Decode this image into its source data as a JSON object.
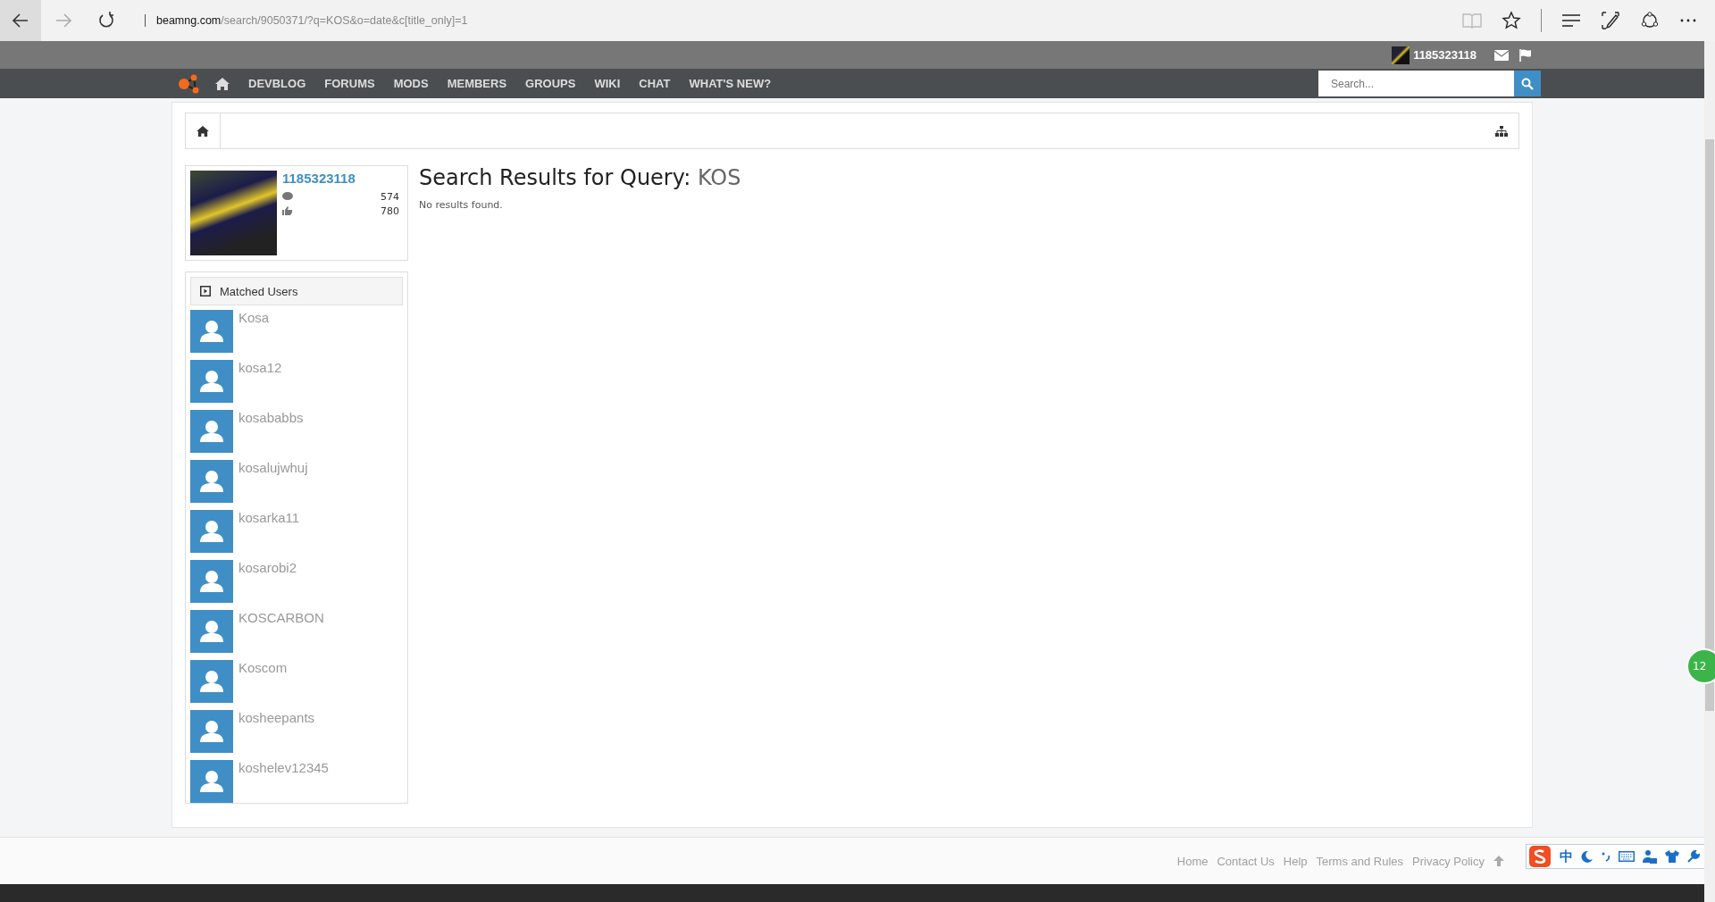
{
  "browser": {
    "url_domain": "beamng.com",
    "url_path": "/search/9050371/?q=KOS&o=date&c[title_only]=1"
  },
  "header": {
    "username": "1185323118"
  },
  "nav": {
    "items": [
      "DEVBLOG",
      "FORUMS",
      "MODS",
      "MEMBERS",
      "GROUPS",
      "WIKI",
      "CHAT",
      "WHAT'S NEW?"
    ],
    "search_placeholder": "Search..."
  },
  "user_card": {
    "name": "1185323118",
    "messages": "574",
    "likes": "780"
  },
  "results": {
    "title": "Search Results for Query:",
    "query": "KOS",
    "message": "No results found."
  },
  "matched_users": {
    "title": "Matched Users",
    "users": [
      "Kosa",
      "kosa12",
      "kosababbs",
      "kosalujwhuj",
      "kosarka11",
      "kosarobi2",
      "KOSCARBON",
      "Koscom",
      "kosheepants",
      "koshelev12345"
    ]
  },
  "footer": {
    "links": [
      "Home",
      "Contact Us",
      "Help",
      "Terms and Rules",
      "Privacy Policy"
    ]
  },
  "ime": {
    "label": "中"
  },
  "floating_badge": {
    "label": "12"
  }
}
